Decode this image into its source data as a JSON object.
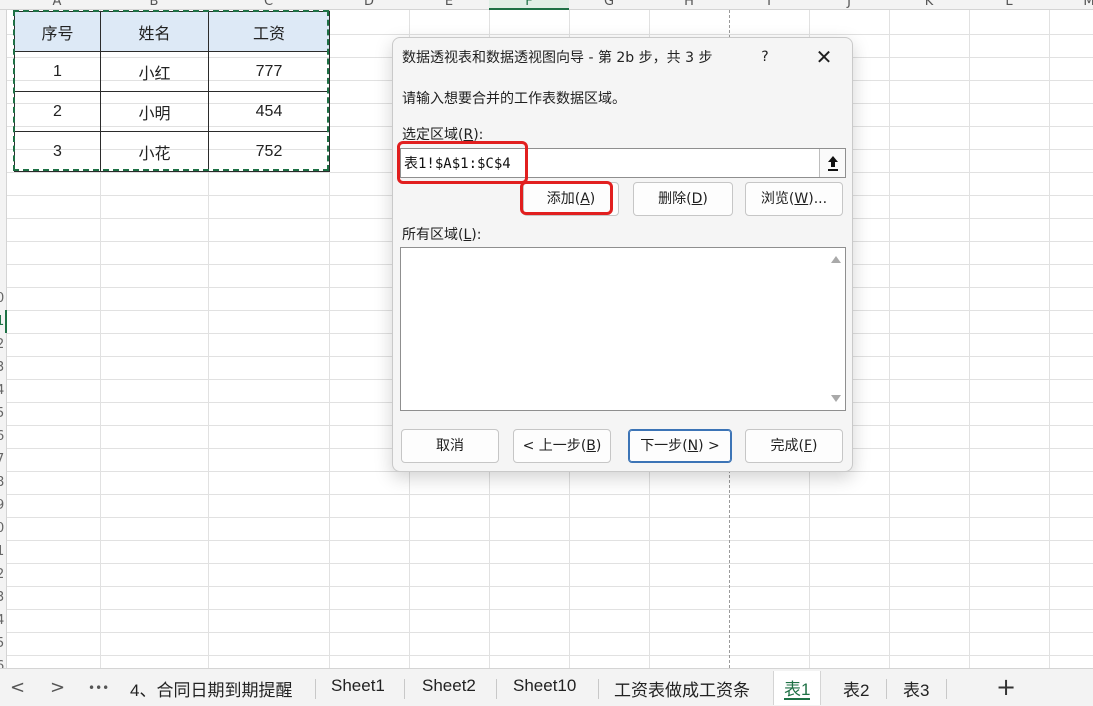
{
  "sheet": {
    "column_letters": [
      "A",
      "B",
      "C",
      "D",
      "E",
      "F",
      "G",
      "H",
      "I",
      "J",
      "K",
      "L",
      "M"
    ],
    "row_numbers": [
      "",
      "",
      "",
      "",
      "",
      "",
      "",
      "",
      "",
      "",
      "",
      "",
      "0",
      "1",
      "2",
      "3",
      "4",
      "5",
      "6",
      "7",
      "8",
      "9",
      "0",
      "1",
      "2",
      "3",
      "4",
      "5",
      "6"
    ],
    "table": {
      "headers": [
        "序号",
        "姓名",
        "工资"
      ],
      "rows": [
        [
          "1",
          "小红",
          "777"
        ],
        [
          "2",
          "小明",
          "454"
        ],
        [
          "3",
          "小花",
          "752"
        ]
      ]
    }
  },
  "dialog": {
    "title": "数据透视表和数据透视图向导 - 第 2b 步，共 3 步",
    "help_label": "?",
    "close_label": "✕",
    "instruction": "请输入想要合并的工作表数据区域。",
    "range_label": "选定区域",
    "range_label_key": "R",
    "range_value": "表1!$A$1:$C$4",
    "add_button": {
      "text": "添加",
      "key": "A"
    },
    "delete_button": {
      "text": "删除",
      "key": "D"
    },
    "browse_button": {
      "text": "浏览",
      "key": "W",
      "suffix": "..."
    },
    "all_ranges_label": "所有区域",
    "all_ranges_key": "L",
    "cancel_button": "取消",
    "back_button": {
      "text": "< 上一步",
      "key": "B"
    },
    "next_button": {
      "text": "下一步",
      "key": "N",
      "suffix": " >"
    },
    "finish_button": {
      "text": "完成",
      "key": "F"
    }
  },
  "tabs": {
    "nav_prev": "<",
    "nav_next": ">",
    "more": "•••",
    "items": [
      "4、合同日期到期提醒",
      "Sheet1",
      "Sheet2",
      "Sheet10",
      "工资表做成工资条",
      "表1",
      "表2",
      "表3"
    ],
    "active": "表1",
    "add": "+"
  },
  "colors": {
    "accent": "#1e7145",
    "highlight_box": "#e11f1f",
    "header_fill": "#dde9f6",
    "primary_button_border": "#3c74b6"
  }
}
